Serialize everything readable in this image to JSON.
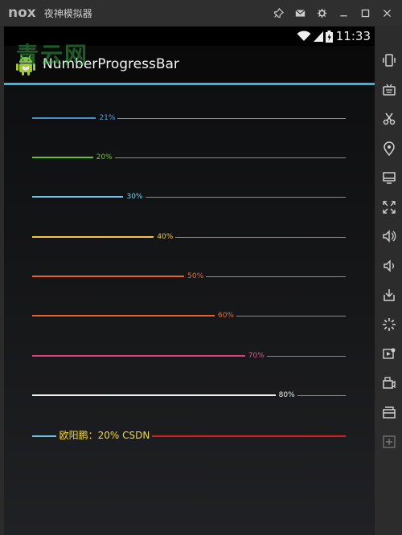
{
  "emulator": {
    "logo": "nox",
    "title": "夜神模拟器"
  },
  "statusbar": {
    "time": "11:33"
  },
  "actionbar": {
    "title": "NumberProgressBar"
  },
  "watermark": "青云网",
  "progress_bars": [
    {
      "label": "21%",
      "percent": 21,
      "reached_color": "#4a90c8",
      "text_color": "#5b9fd6"
    },
    {
      "label": "20%",
      "percent": 20,
      "reached_color": "#6abf2b",
      "text_color": "#7bc63a"
    },
    {
      "label": "30%",
      "percent": 30,
      "reached_color": "#6cc2e8",
      "text_color": "#7ecdf0"
    },
    {
      "label": "40%",
      "percent": 40,
      "reached_color": "#f5c542",
      "text_color": "#f5c542"
    },
    {
      "label": "50%",
      "percent": 50,
      "reached_color": "#e8622c",
      "text_color": "#ea6a35"
    },
    {
      "label": "60%",
      "percent": 60,
      "reached_color": "#e8622c",
      "text_color": "#ea6a35"
    },
    {
      "label": "70%",
      "percent": 70,
      "reached_color": "#e0407a",
      "text_color": "#e6508a"
    },
    {
      "label": "80%",
      "percent": 80,
      "reached_color": "#f0f0f0",
      "text_color": "#f0f0f0"
    },
    {
      "label": "欧阳鹏：20%  CSDN",
      "percent": 20,
      "reached_color": "#6cc2e8",
      "text_color": "#f5d742",
      "unreached_color": "#d81e1e",
      "big": true
    }
  ],
  "colors": {
    "accent_line": "#33b5e5",
    "unreached_default": "#8a8a8a"
  },
  "sidebar_icons": [
    "phone-shake-icon",
    "keyboard-icon",
    "scissors-icon",
    "location-icon",
    "screen-icon",
    "fullscreen-icon",
    "volume-up-icon",
    "volume-down-icon",
    "apk-install-icon",
    "loading-icon",
    "video-record-icon",
    "camera-icon",
    "folder-icon",
    "add-icon"
  ]
}
